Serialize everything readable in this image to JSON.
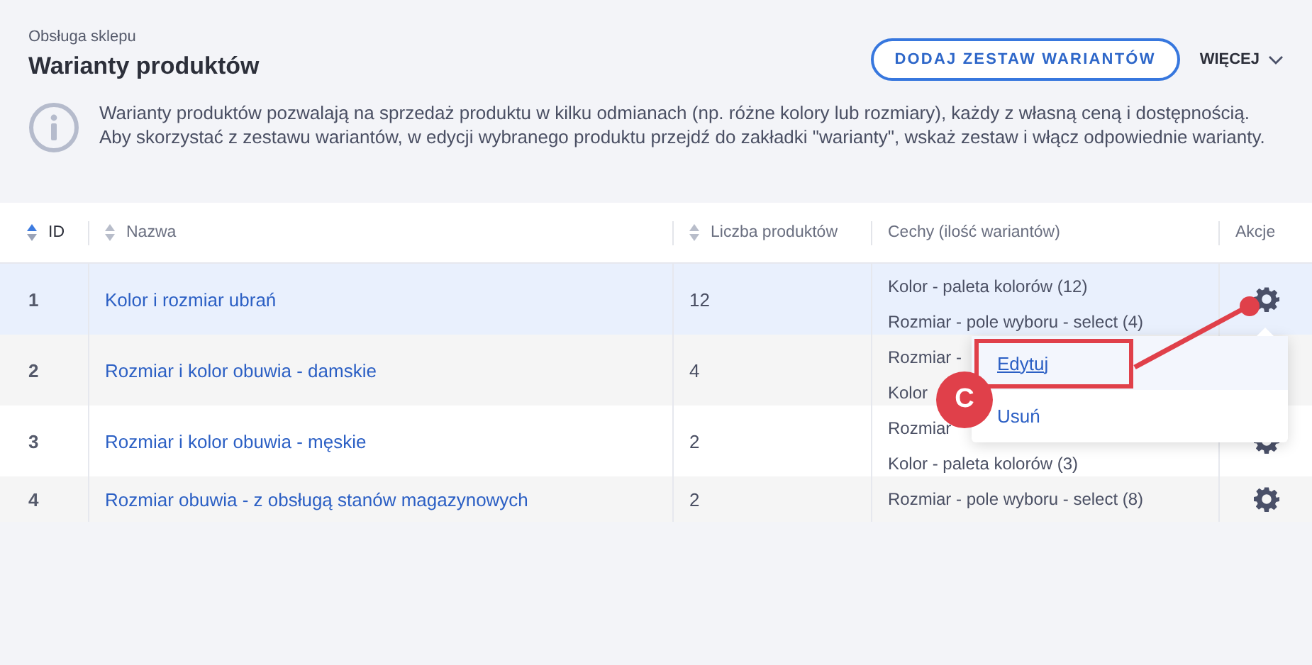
{
  "breadcrumb": "Obsługa sklepu",
  "title": "Warianty produktów",
  "add_button": "DODAJ ZESTAW WARIANTÓW",
  "more_menu": "WIĘCEJ",
  "info": [
    "Warianty produktów pozwalają na sprzedaż produktu w kilku odmianach (np. różne kolory lub rozmiary), każdy z własną ceną i dostępnością.",
    "Aby skorzystać z zestawu wariantów, w edycji wybranego produktu przejdź do zakładki \"warianty\", wskaż zestaw i włącz odpowiednie warianty."
  ],
  "table": {
    "columns": [
      {
        "label": "ID",
        "sortable": true,
        "sort_active": true
      },
      {
        "label": "Nazwa",
        "sortable": true,
        "sort_active": false
      },
      {
        "label": "Liczba produktów",
        "sortable": true,
        "sort_active": false
      },
      {
        "label": "Cechy (ilość wariantów)",
        "sortable": false
      },
      {
        "label": "Akcje",
        "sortable": false
      }
    ],
    "rows": [
      {
        "id": "1",
        "name": "Kolor i rozmiar ubrań",
        "count": "12",
        "features": [
          "Kolor - paleta kolorów (12)",
          "Rozmiar - pole wyboru - select (4)"
        ],
        "selected": true
      },
      {
        "id": "2",
        "name": "Rozmiar i kolor obuwia - damskie",
        "count": "4",
        "features": [
          "Rozmiar -",
          "Kolor"
        ],
        "selected": false
      },
      {
        "id": "3",
        "name": "Rozmiar i kolor obuwia - męskie",
        "count": "2",
        "features": [
          "Rozmiar",
          "Kolor - paleta kolorów (3)"
        ],
        "selected": false
      },
      {
        "id": "4",
        "name": "Rozmiar obuwia - z obsługą stanów magazynowych",
        "count": "2",
        "features": [
          "Rozmiar - pole wyboru - select (8)"
        ],
        "selected": false
      }
    ]
  },
  "actions_menu": {
    "items": [
      {
        "label": "Edytuj",
        "selected": true
      },
      {
        "label": "Usuń",
        "selected": false
      }
    ]
  },
  "annotation": {
    "label": "C"
  }
}
